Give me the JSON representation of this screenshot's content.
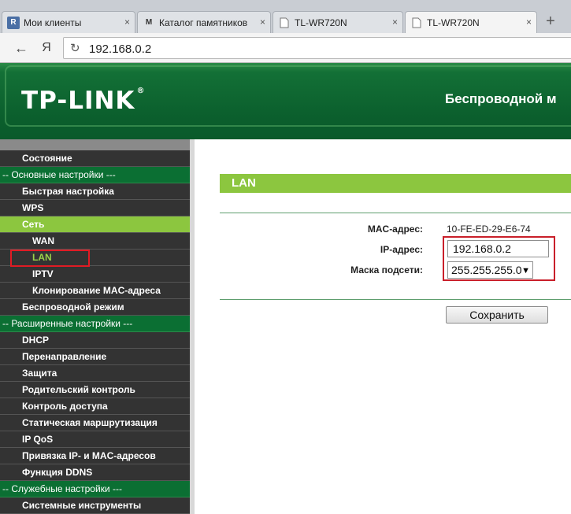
{
  "browser": {
    "tabs": [
      {
        "label": "Мои клиенты",
        "favicon": "R",
        "active": false
      },
      {
        "label": "Каталог памятников",
        "favicon": "M",
        "active": false
      },
      {
        "label": "TL-WR720N",
        "favicon": "",
        "active": false
      },
      {
        "label": "TL-WR720N",
        "favicon": "",
        "active": true
      }
    ],
    "new_tab": "+",
    "close_glyph": "×",
    "back": "←",
    "yandex": "Я",
    "reload": "↻",
    "url": "192.168.0.2"
  },
  "header": {
    "logo": "TP-LINK",
    "logo_mark": "®",
    "title": "Беспроводной м"
  },
  "menu": {
    "items": [
      {
        "label": "Состояние",
        "type": "lvl1"
      },
      {
        "label": "-- Основные настройки ---",
        "type": "section"
      },
      {
        "label": "Быстрая настройка",
        "type": "lvl1"
      },
      {
        "label": "WPS",
        "type": "lvl1"
      },
      {
        "label": "Сеть",
        "type": "lvl1",
        "state": "active"
      },
      {
        "label": "WAN",
        "type": "lvl2"
      },
      {
        "label": "LAN",
        "type": "lvl2",
        "state": "current"
      },
      {
        "label": "IPTV",
        "type": "lvl2"
      },
      {
        "label": "Клонирование MAC-адреса",
        "type": "lvl2"
      },
      {
        "label": "Беспроводной режим",
        "type": "lvl1"
      },
      {
        "label": "-- Расширенные настройки ---",
        "type": "section"
      },
      {
        "label": "DHCP",
        "type": "lvl1"
      },
      {
        "label": "Перенаправление",
        "type": "lvl1"
      },
      {
        "label": "Защита",
        "type": "lvl1"
      },
      {
        "label": "Родительский контроль",
        "type": "lvl1"
      },
      {
        "label": "Контроль доступа",
        "type": "lvl1"
      },
      {
        "label": "Статическая маршрутизация",
        "type": "lvl1"
      },
      {
        "label": "IP QoS",
        "type": "lvl1"
      },
      {
        "label": "Привязка IP- и MAC-адресов",
        "type": "lvl1"
      },
      {
        "label": "Функция DDNS",
        "type": "lvl1"
      },
      {
        "label": "-- Служебные настройки ---",
        "type": "section"
      },
      {
        "label": "Системные инструменты",
        "type": "lvl1"
      }
    ]
  },
  "content": {
    "section_title": "LAN",
    "mac_label": "MAC-адрес:",
    "mac_value": "10-FE-ED-29-E6-74",
    "ip_label": "IP-адрес:",
    "ip_value": "192.168.0.2",
    "mask_label": "Маска подсети:",
    "mask_value": "255.255.255.0",
    "save_label": "Сохранить"
  },
  "colors": {
    "brand_green": "#0b5f2d",
    "accent_green": "#8cc63f",
    "highlight_red": "#e01b24"
  }
}
